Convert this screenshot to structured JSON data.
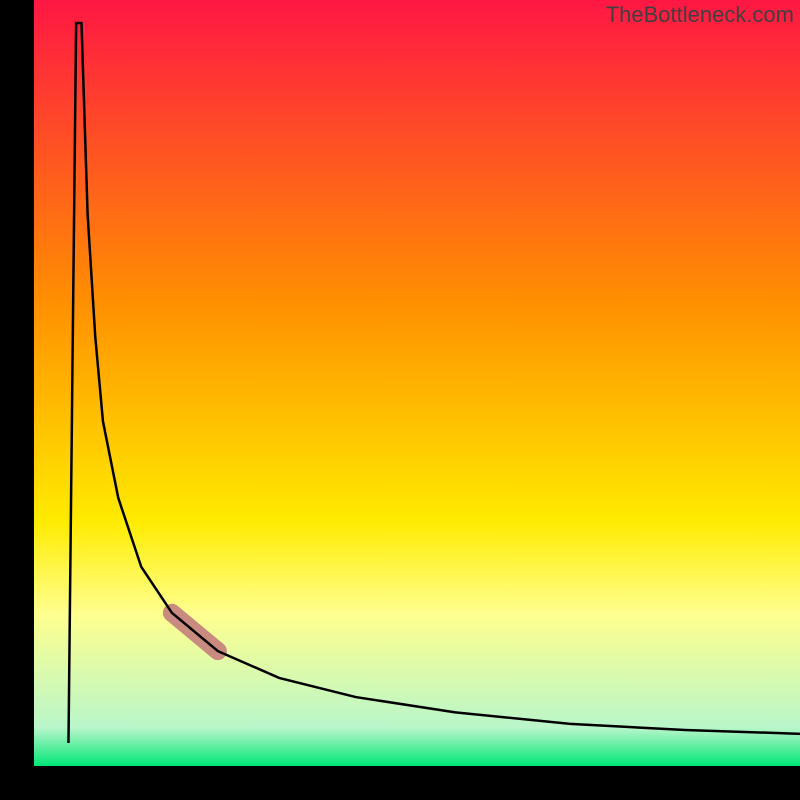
{
  "attribution": "TheBottleneck.com",
  "chart_data": {
    "type": "line",
    "title": "",
    "xlabel": "",
    "ylabel": "",
    "xlim": [
      0,
      100
    ],
    "ylim": [
      0,
      100
    ],
    "gradient_stops": [
      {
        "offset": 0,
        "color": "#ff1744"
      },
      {
        "offset": 40,
        "color": "#ff9100"
      },
      {
        "offset": 68,
        "color": "#ffeb00"
      },
      {
        "offset": 80,
        "color": "#ffff8d"
      },
      {
        "offset": 95,
        "color": "#b9f6ca"
      },
      {
        "offset": 100,
        "color": "#00e676"
      }
    ],
    "curve_points": [
      {
        "x": 4.5,
        "y": 3
      },
      {
        "x": 5.5,
        "y": 97
      },
      {
        "x": 6.2,
        "y": 97
      },
      {
        "x": 7,
        "y": 72
      },
      {
        "x": 8,
        "y": 56
      },
      {
        "x": 9,
        "y": 45
      },
      {
        "x": 11,
        "y": 35
      },
      {
        "x": 14,
        "y": 26
      },
      {
        "x": 18,
        "y": 20
      },
      {
        "x": 24,
        "y": 15
      },
      {
        "x": 32,
        "y": 11.5
      },
      {
        "x": 42,
        "y": 9
      },
      {
        "x": 55,
        "y": 7
      },
      {
        "x": 70,
        "y": 5.5
      },
      {
        "x": 85,
        "y": 4.7
      },
      {
        "x": 100,
        "y": 4.2
      }
    ],
    "highlight_segment": {
      "x_start": 18,
      "y_start": 20,
      "x_end": 24,
      "y_end": 15,
      "color": "#c98a7f",
      "width": 18
    },
    "axes_color": "#000000",
    "curve_color": "#000000"
  }
}
